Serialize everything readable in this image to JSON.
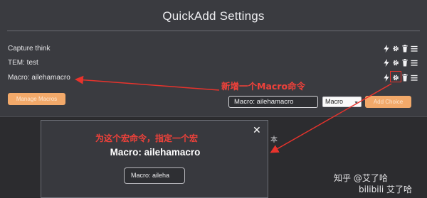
{
  "settings": {
    "title": "QuickAdd Settings",
    "choices": [
      {
        "label": "Capture think"
      },
      {
        "label": "TEM: test"
      },
      {
        "label": "Macro: ailehamacro"
      }
    ],
    "manage_macros_label": "Manage Macros",
    "name_input_value": "Macro: ailehamacro",
    "type_select_value": "Macro",
    "add_choice_label": "Add Choice"
  },
  "background_text": "本",
  "modal": {
    "title": "Macro: ailehamacro",
    "input_value": "Macro: aileha",
    "close_glyph": "✕"
  },
  "annotations": {
    "new_macro": "新增一个Macro命令",
    "assign_macro": "为这个宏命令，指定一个宏",
    "color": "#e8332c"
  },
  "watermark": {
    "line1": "知乎 @艾了哈",
    "line2": "bilibili 艾了哈"
  },
  "icons": [
    "bolt-icon",
    "gear-icon",
    "trash-icon",
    "menu-icon"
  ]
}
